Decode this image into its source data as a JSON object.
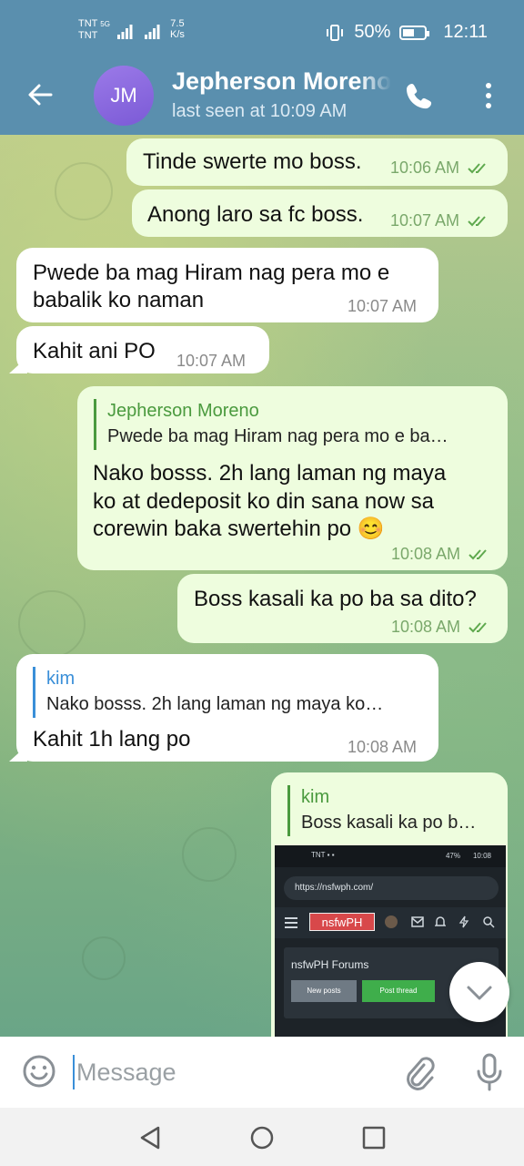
{
  "status": {
    "carrier_1": "TNT",
    "carrier_1_tag": "5G",
    "carrier_2": "TNT",
    "speed_value": "7.5",
    "speed_unit": "K/s",
    "battery": "50%",
    "time": "12:11"
  },
  "header": {
    "avatar_initials": "JM",
    "title": "Jepherson Moreno",
    "subtitle": "last seen at 10:09 AM"
  },
  "messages": [
    {
      "dir": "out",
      "text": "Tinde swerte mo boss.",
      "time": "10:06 AM"
    },
    {
      "dir": "out",
      "text": "Anong laro sa fc boss.",
      "time": "10:07 AM"
    },
    {
      "dir": "in",
      "lines": [
        "Pwede ba mag Hiram nag pera mo e",
        "babalik ko naman"
      ],
      "time": "10:07 AM"
    },
    {
      "dir": "in",
      "text": "Kahit ani PO",
      "time": "10:07 AM"
    },
    {
      "dir": "out",
      "reply_name": "Jepherson Moreno",
      "reply_text": "Pwede ba mag Hiram nag pera mo e ba…",
      "lines": [
        "Nako bosss. 2h lang laman ng maya",
        "ko at dedeposit ko din sana now sa",
        "corewin baka swertehin po"
      ],
      "emoji": "😊",
      "time": "10:08 AM"
    },
    {
      "dir": "out",
      "text": "Boss kasali ka po ba sa dito?",
      "time": "10:08 AM"
    },
    {
      "dir": "in",
      "reply_name": "kim",
      "reply_text": "Nako bosss. 2h lang laman ng maya ko…",
      "text": "Kahit 1h lang po",
      "time": "10:08 AM"
    },
    {
      "dir": "out",
      "reply_name": "kim",
      "reply_text": "Boss kasali ka po b…"
    }
  ],
  "screenshot": {
    "time": "10:08",
    "battery": "47%",
    "url": "https://nsfwph.com/",
    "logo": "nsfwPH",
    "forum_title": "nsfwPH Forums",
    "new_posts": "New posts",
    "post_thread": "Post thread"
  },
  "composer": {
    "placeholder": "Message"
  },
  "colors": {
    "header": "#5a8fae",
    "outgoing_bubble": "#eefdde",
    "incoming_bubble": "#ffffff",
    "accent_name": "#4a9a3e",
    "reply_kim_in": "#3a8fd8"
  }
}
